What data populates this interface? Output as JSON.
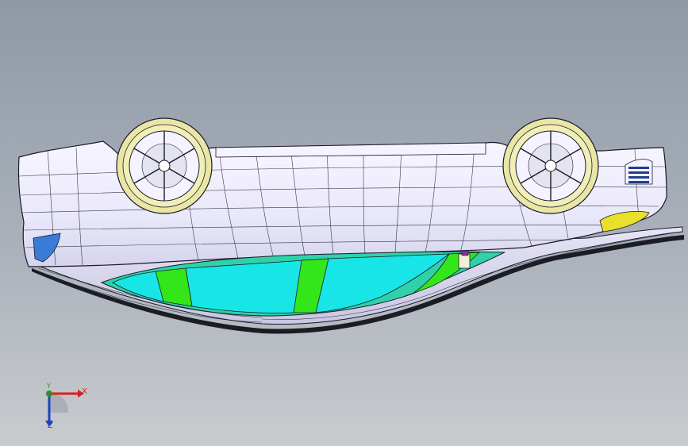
{
  "viewport": {
    "background_top": "#8f99a6",
    "background_bottom": "#c9cccf"
  },
  "model": {
    "body_color": "#ecebfb",
    "edge_color": "#1a1a2a",
    "glass_color": "#18e6e6",
    "pillar_color": "#33e61a",
    "wheel_rim_color": "#eeeaa8",
    "indicator_color": "#e8e02a",
    "lamp_color": "#3a7bd5"
  },
  "triad": {
    "x_label": "X",
    "y_label": "Y",
    "z_label": "Z",
    "x_color": "#d92020",
    "y_color": "#2f8f2f",
    "z_color": "#2040c0"
  }
}
